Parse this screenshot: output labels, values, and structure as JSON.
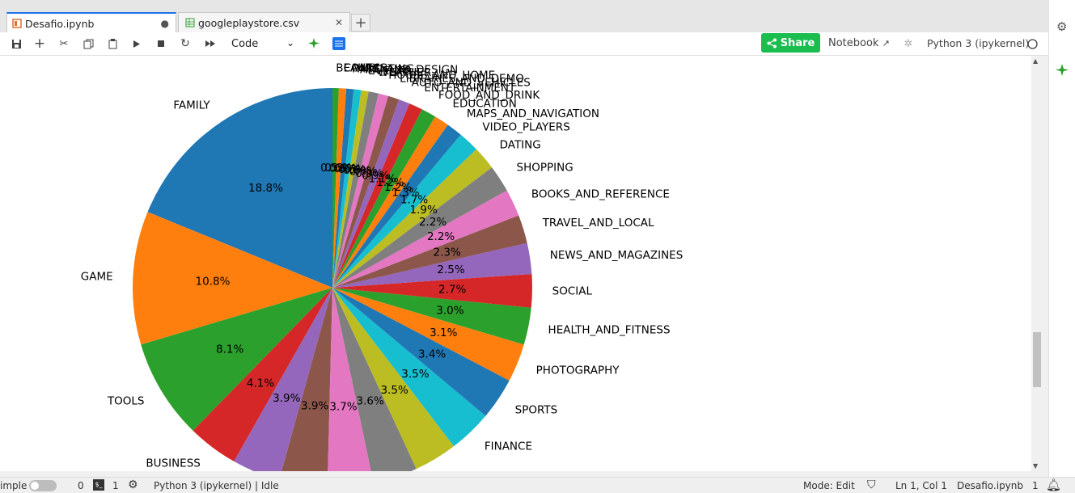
{
  "tabs": [
    {
      "label": "Desafio.ipynb",
      "icon": "notebook-icon",
      "status": "●"
    },
    {
      "label": "googleplaystore.csv",
      "icon": "spreadsheet-icon",
      "status": "✕"
    }
  ],
  "new_tab": "+",
  "toolbar": {
    "cell_type": "Code",
    "share_label": "Share",
    "notebook_label": "Notebook",
    "kernel_label": "Python 3 (ipykernel)"
  },
  "status": {
    "mode_label": "imple",
    "count_a": "0",
    "count_b": "1",
    "kernel_status": "Python 3 (ipykernel) | Idle",
    "mode": "Mode: Edit",
    "position": "Ln 1, Col 1",
    "filename": "Desafio.ipynb",
    "notifications": "1"
  },
  "colors": {
    "accent": "#1a73e8",
    "share": "#1bbd4f"
  },
  "chart_data": {
    "type": "pie",
    "start_angle_deg": 90,
    "direction": "counterclockwise",
    "slices": [
      {
        "label": "FAMILY",
        "pct": "18.8%",
        "value": 18.8
      },
      {
        "label": "GAME",
        "pct": "10.8%",
        "value": 10.8
      },
      {
        "label": "TOOLS",
        "pct": "8.1%",
        "value": 8.1
      },
      {
        "label": "BUSINESS",
        "pct": "4.1%",
        "value": 4.1
      },
      {
        "label": "",
        "pct": "3.9%",
        "value": 3.9
      },
      {
        "label": "",
        "pct": "3.9%",
        "value": 3.9
      },
      {
        "label": "",
        "pct": "3.7%",
        "value": 3.7
      },
      {
        "label": "",
        "pct": "3.6%",
        "value": 3.6
      },
      {
        "label": "",
        "pct": "3.5%",
        "value": 3.5
      },
      {
        "label": "FINANCE",
        "pct": "3.5%",
        "value": 3.5
      },
      {
        "label": "SPORTS",
        "pct": "3.4%",
        "value": 3.4
      },
      {
        "label": "PHOTOGRAPHY",
        "pct": "3.1%",
        "value": 3.1
      },
      {
        "label": "HEALTH_AND_FITNESS",
        "pct": "3.0%",
        "value": 3.0
      },
      {
        "label": "SOCIAL",
        "pct": "2.7%",
        "value": 2.7
      },
      {
        "label": "NEWS_AND_MAGAZINES",
        "pct": "2.5%",
        "value": 2.5
      },
      {
        "label": "TRAVEL_AND_LOCAL",
        "pct": "2.3%",
        "value": 2.3
      },
      {
        "label": "BOOKS_AND_REFERENCE",
        "pct": "2.2%",
        "value": 2.2
      },
      {
        "label": "SHOPPING",
        "pct": "2.2%",
        "value": 2.2
      },
      {
        "label": "DATING",
        "pct": "1.9%",
        "value": 1.9
      },
      {
        "label": "VIDEO_PLAYERS",
        "pct": "1.7%",
        "value": 1.7
      },
      {
        "label": "MAPS_AND_NAVIGATION",
        "pct": "1.3%",
        "value": 1.3
      },
      {
        "label": "EDUCATION",
        "pct": "1.2%",
        "value": 1.2
      },
      {
        "label": "FOOD_AND_DRINK",
        "pct": "1.2%",
        "value": 1.2
      },
      {
        "label": "ENTERTAINMENT",
        "pct": "1.1%",
        "value": 1.1
      },
      {
        "label": "AUTO_AND_VEHICLES",
        "pct": "0.9%",
        "value": 0.9
      },
      {
        "label": "LIBRARIES_AND_DEMO",
        "pct": "0.9%",
        "value": 0.9
      },
      {
        "label": "HOUSE_AND_HOME",
        "pct": "0.8%",
        "value": 0.8
      },
      {
        "label": "WEATHER",
        "pct": "0.8%",
        "value": 0.8
      },
      {
        "label": "EVENTS",
        "pct": "0.6%",
        "value": 0.6
      },
      {
        "label": "ART_AND_DESIGN",
        "pct": "0.6%",
        "value": 0.6
      },
      {
        "label": "PARENTING",
        "pct": "0.6%",
        "value": 0.6
      },
      {
        "label": "COMICS",
        "pct": "0.6%",
        "value": 0.6
      },
      {
        "label": "BEAUTY",
        "pct": "0.5%",
        "value": 0.5
      }
    ],
    "palette": [
      "#1f77b4",
      "#ff7f0e",
      "#2ca02c",
      "#d62728",
      "#9467bd",
      "#8c564b",
      "#e377c2",
      "#7f7f7f",
      "#bcbd22",
      "#17becf"
    ]
  }
}
